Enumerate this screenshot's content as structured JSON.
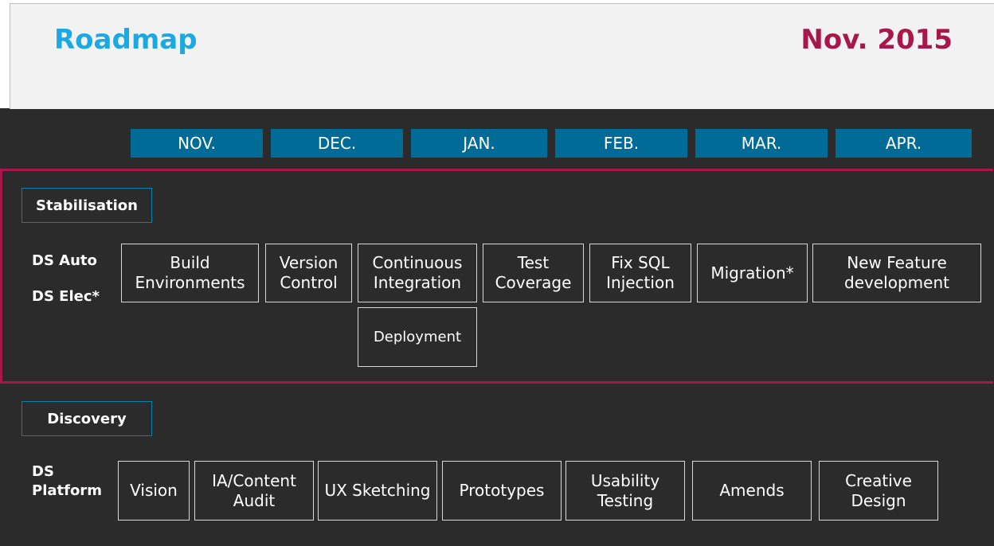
{
  "header": {
    "title": "Roadmap",
    "date": "Nov. 2015"
  },
  "months": [
    "NOV.",
    "DEC.",
    "JAN.",
    "FEB.",
    "MAR.",
    "APR."
  ],
  "stabilisation": {
    "label": "Stabilisation",
    "rows": [
      "DS Auto",
      "DS Elec*"
    ],
    "tasks": [
      "Build Environments",
      "Version Control",
      "Continuous Integration",
      "Test Coverage",
      "Fix SQL Injection",
      "Migration*",
      "New Feature development",
      "Deployment"
    ]
  },
  "discovery": {
    "label": "Discovery",
    "rows": [
      "DS Platform"
    ],
    "tasks": [
      "Vision",
      "IA/Content Audit",
      "UX Sketching",
      "Prototypes",
      "Usability Testing",
      "Amends",
      "Creative Design"
    ]
  },
  "colors": {
    "title": "#1ca8e0",
    "date": "#a8174a",
    "month_bar": "#006b96",
    "highlight_frame": "#a8174a",
    "background": "#2b2b2b"
  }
}
